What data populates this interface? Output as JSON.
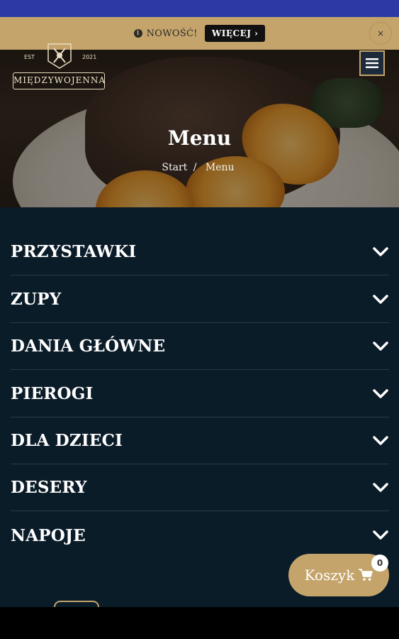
{
  "notice": {
    "icon": "info-icon",
    "text": "NOWOŚĆ!",
    "button_label": "WIĘCEJ ›",
    "close_label": "×"
  },
  "header": {
    "logo": {
      "est": "EST",
      "year": "2021",
      "name": "MIĘDZYWOJENNA"
    }
  },
  "hero": {
    "title": "Menu",
    "breadcrumb": {
      "home": "Start",
      "separator": "/",
      "current": "Menu"
    }
  },
  "menu": {
    "categories": [
      {
        "label": "PRZYSTAWKI"
      },
      {
        "label": "ZUPY"
      },
      {
        "label": "DANIA GŁÓWNE"
      },
      {
        "label": "PIEROGI"
      },
      {
        "label": "DLA DZIECI"
      },
      {
        "label": "DESERY"
      },
      {
        "label": "NAPOJE"
      }
    ]
  },
  "cart": {
    "label": "Koszyk",
    "count": "0"
  },
  "colors": {
    "accent": "#c5a46b",
    "menu_bg": "#0b1c29",
    "status_bar": "#2d3aa6"
  }
}
